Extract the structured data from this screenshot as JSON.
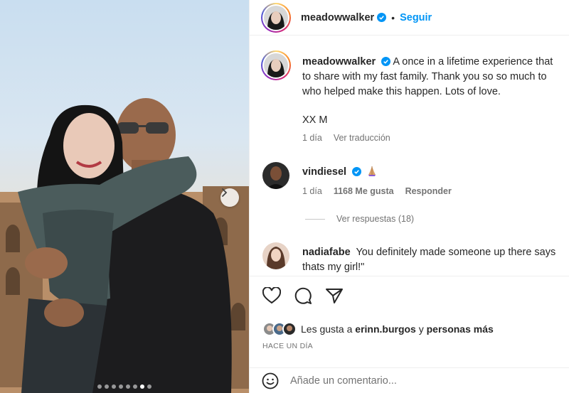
{
  "post": {
    "author": "meadowwalker",
    "follow_label": "Seguir",
    "separator": "•"
  },
  "caption": {
    "username": "meadowwalker",
    "line1": "A once in a lifetime experience that",
    "line2": "to share with my fast family. Thank you so so much to",
    "line3": "who helped make this happen. Lots of love.",
    "signoff": "XX M",
    "time": "1 día",
    "translate_label": "Ver traducción"
  },
  "comments": [
    {
      "username": "vindiesel",
      "text": "",
      "emoji": "praying-hands",
      "time": "1 día",
      "likes": "1168 Me gusta",
      "reply_label": "Responder",
      "view_replies": "Ver respuestas (18)"
    },
    {
      "username": "nadiafabe",
      "line1": "You definitely made someone up there says",
      "line2": "thats my girl!\""
    }
  ],
  "likes": {
    "prefix": "Les gusta a",
    "user": "erinn.burgos",
    "conj": "y",
    "rest": "personas más"
  },
  "date_label": "HACE UN DÍA",
  "comment_input": {
    "placeholder": "Añade un comentario..."
  },
  "carousel": {
    "total_slides": 8,
    "active_slide": 7
  },
  "colors": {
    "accent": "#0095f6",
    "verified": "#0095f6",
    "text": "#262626",
    "muted": "#737373"
  },
  "icons": [
    "heart-icon",
    "comment-icon",
    "share-icon",
    "verified-icon",
    "emoji-icon",
    "chevron-right-icon"
  ]
}
